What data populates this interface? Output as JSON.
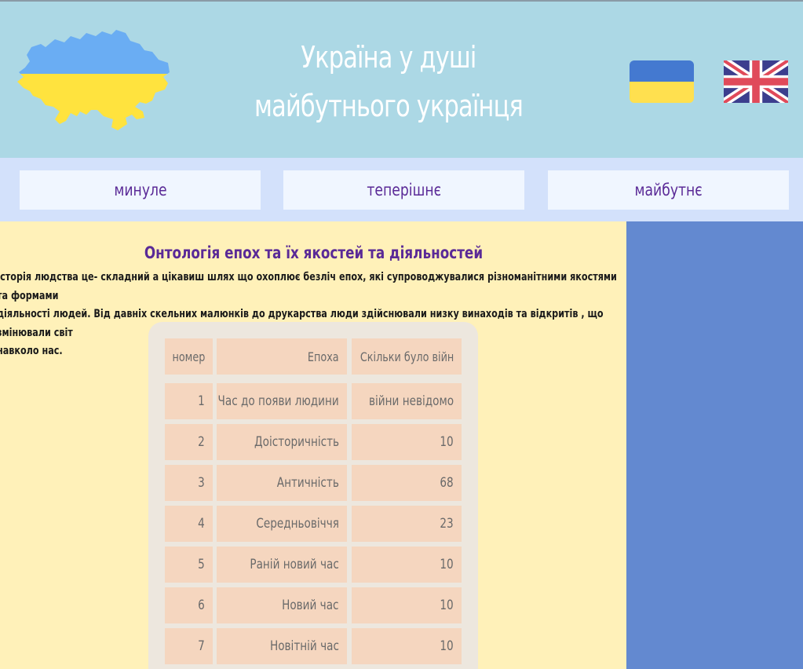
{
  "header": {
    "title_line1": "Україна у душі",
    "title_line2": "майбутнього українця"
  },
  "nav": {
    "items": [
      {
        "label": "минуле"
      },
      {
        "label": "теперішнє"
      },
      {
        "label": "майбутнє"
      }
    ]
  },
  "main": {
    "heading": "Онтологія епох та їх якостей та діяльностей",
    "paragraph_lines": [
      "Історія людства це- складний а цікавиш шлях що охоплює безліч епох, які супроводжувалися різноманітними якостями та формами",
      "діяльності людей. Від давніх скельних малюнків до друкарства люди здійснювали низку винаходів та відкритів , що змінювали світ",
      "навколо нас."
    ],
    "table": {
      "headers": [
        "номер",
        "Епоха",
        "Скільки було війн"
      ],
      "rows": [
        [
          "1",
          "Час до появи людини",
          "війни невідомо"
        ],
        [
          "2",
          "Доісторичність",
          "10"
        ],
        [
          "3",
          "Античність",
          "68"
        ],
        [
          "4",
          "Середньовіччя",
          "23"
        ],
        [
          "5",
          "Раній новий час",
          "10"
        ],
        [
          "6",
          "Новий час",
          "10"
        ],
        [
          "7",
          "Новітній час",
          "10"
        ]
      ]
    }
  },
  "colors": {
    "header_bg": "#acd8e5",
    "nav_bg": "#d3e1fb",
    "nav_item_bg": "#f0f6ff",
    "accent_purple": "#5a2a97",
    "main_bg": "#fff1b9",
    "aside_bg": "#6389d0",
    "table_cell_bg": "#f5d6bf",
    "flag_blue": "#4479d0",
    "flag_yellow": "#ffe04f"
  },
  "icons": {
    "map": "ukraine-map-icon",
    "flag_ua": "ukraine-flag-icon",
    "flag_uk": "uk-flag-icon"
  }
}
